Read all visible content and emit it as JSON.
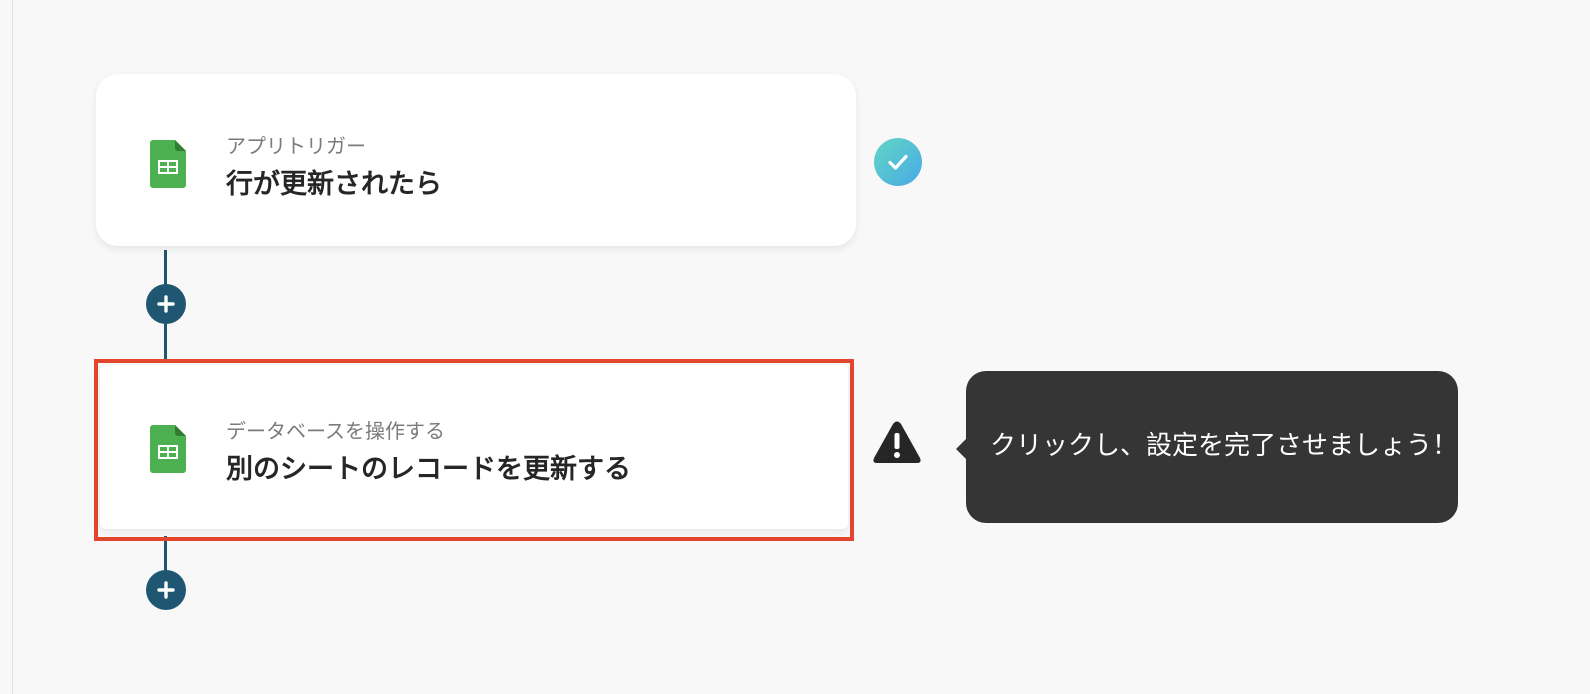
{
  "flow": {
    "steps": [
      {
        "icon": "google-sheets-icon",
        "type_label": "アプリトリガー",
        "title": "行が更新されたら",
        "status": "completed",
        "status_icon": "check-icon"
      },
      {
        "icon": "google-sheets-icon",
        "type_label": "データベースを操作する",
        "title": "別のシートのレコードを更新する",
        "status": "warning",
        "status_icon": "warning-icon",
        "selected": true
      }
    ],
    "add_step_icon": "plus-icon"
  },
  "tooltip": {
    "text": "クリックし、設定を完了させましょう！"
  },
  "colors": {
    "background": "#f8f8f8",
    "connector": "#1f5672",
    "selection_border": "#e2472d",
    "sheets_green": "#4caf50",
    "success_gradient_start": "#63d6c4",
    "success_gradient_end": "#47a9e6",
    "tooltip_bg": "#353535",
    "warning": "#262626"
  }
}
